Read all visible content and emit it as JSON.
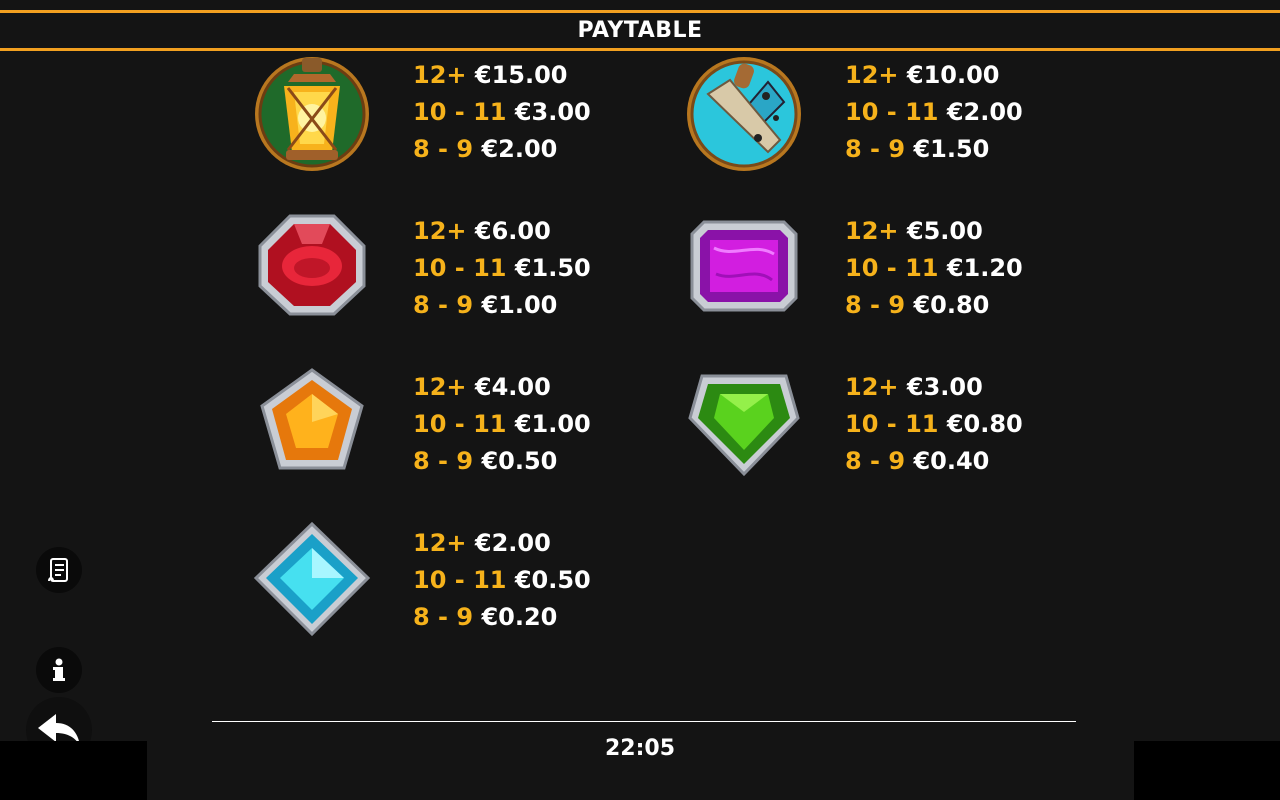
{
  "header": {
    "title": "PAYTABLE"
  },
  "symbols": [
    {
      "name": "lantern",
      "pays": [
        {
          "count": "12+",
          "value": "€15.00"
        },
        {
          "count": "10 - 11",
          "value": "€3.00"
        },
        {
          "count": "8 - 9",
          "value": "€2.00"
        }
      ]
    },
    {
      "name": "pickaxe",
      "pays": [
        {
          "count": "12+",
          "value": "€10.00"
        },
        {
          "count": "10 - 11",
          "value": "€2.00"
        },
        {
          "count": "8 - 9",
          "value": "€1.50"
        }
      ]
    },
    {
      "name": "red gem",
      "pays": [
        {
          "count": "12+",
          "value": "€6.00"
        },
        {
          "count": "10 - 11",
          "value": "€1.50"
        },
        {
          "count": "8 - 9",
          "value": "€1.00"
        }
      ]
    },
    {
      "name": "purple gem",
      "pays": [
        {
          "count": "12+",
          "value": "€5.00"
        },
        {
          "count": "10 - 11",
          "value": "€1.20"
        },
        {
          "count": "8 - 9",
          "value": "€0.80"
        }
      ]
    },
    {
      "name": "orange gem",
      "pays": [
        {
          "count": "12+",
          "value": "€4.00"
        },
        {
          "count": "10 - 11",
          "value": "€1.00"
        },
        {
          "count": "8 - 9",
          "value": "€0.50"
        }
      ]
    },
    {
      "name": "green gem",
      "pays": [
        {
          "count": "12+",
          "value": "€3.00"
        },
        {
          "count": "10 - 11",
          "value": "€0.80"
        },
        {
          "count": "8 - 9",
          "value": "€0.40"
        }
      ]
    },
    {
      "name": "blue gem",
      "pays": [
        {
          "count": "12+",
          "value": "€2.00"
        },
        {
          "count": "10 - 11",
          "value": "€0.50"
        },
        {
          "count": "8 - 9",
          "value": "€0.20"
        }
      ]
    }
  ],
  "sidebar": {
    "paytable_icon": "scroll-icon",
    "info_icon": "info-icon",
    "back_icon": "back-arrow-icon"
  },
  "footer": {
    "clock": "22:05"
  },
  "colors": {
    "accent": "#f2a020",
    "count_text": "#f6b21b",
    "value_text": "#ffffff",
    "background": "#141414"
  }
}
